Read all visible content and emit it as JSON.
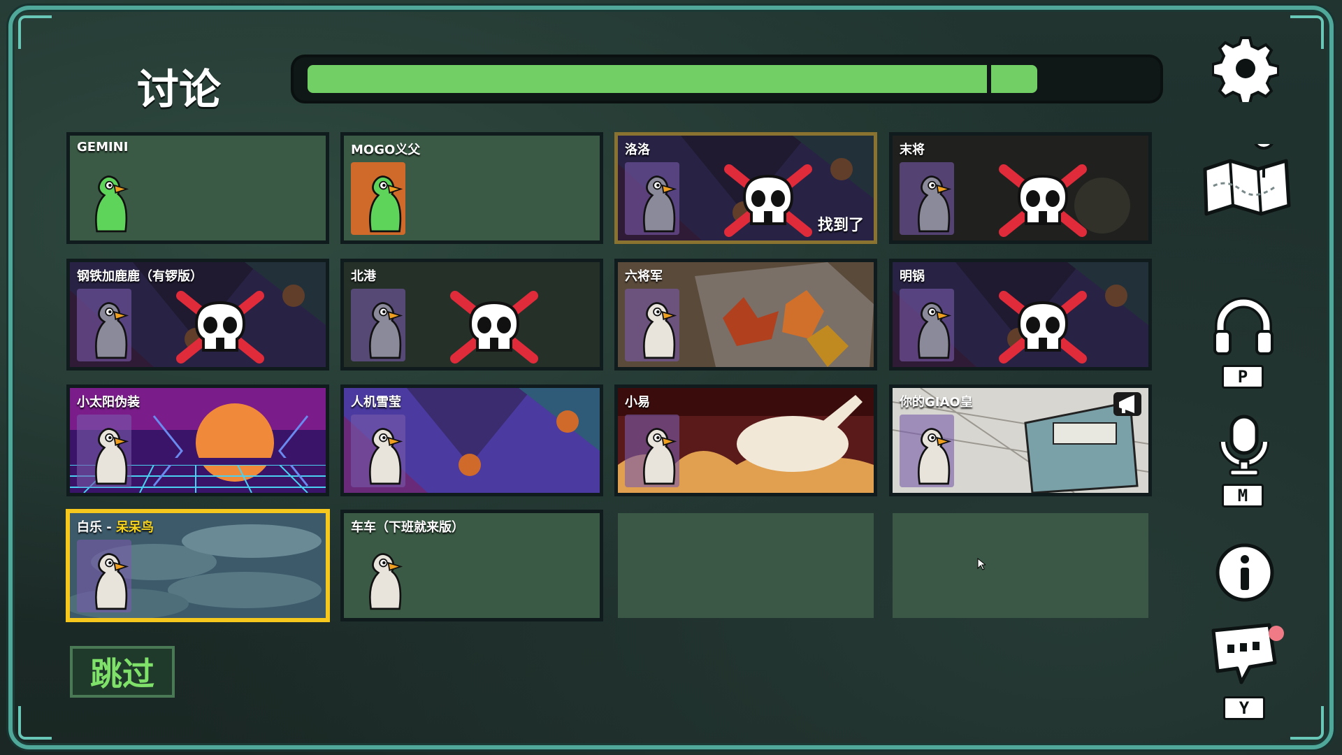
{
  "header": {
    "phase_title": "讨论",
    "timer_progress": 0.87
  },
  "players": [
    {
      "name": "GEMINI",
      "status": "alive",
      "avatar_color": "#5fd45b",
      "bg": "plain"
    },
    {
      "name": "MOGO义父",
      "status": "alive",
      "avatar_color": "#5fd45b",
      "bg": "plain"
    },
    {
      "name": "洛洛",
      "status": "dead",
      "found_label": "找到了",
      "bg": "jester"
    },
    {
      "name": "末将",
      "status": "dead",
      "bg": "dark"
    },
    {
      "name": "钢铁加鹿鹿（有锣版）",
      "status": "dead",
      "bg": "jester"
    },
    {
      "name": "北港",
      "status": "dead",
      "bg": "plain"
    },
    {
      "name": "六将军",
      "status": "alive",
      "bg": "leaves"
    },
    {
      "name": "明锅",
      "status": "dead",
      "bg": "jester"
    },
    {
      "name": "小太阳伪装",
      "status": "alive",
      "bg": "synthwave"
    },
    {
      "name": "人机雪莹",
      "status": "alive",
      "bg": "jester"
    },
    {
      "name": "小易",
      "status": "alive",
      "bg": "rabbit"
    },
    {
      "name": "你的GIAO皇",
      "status": "alive",
      "bg": "comic",
      "speaking": true
    },
    {
      "name": "白乐",
      "separator": " - ",
      "alias": "呆呆鸟",
      "status": "alive",
      "bg": "fish",
      "is_self": true
    },
    {
      "name": "车车（下班就来版）",
      "status": "alive",
      "bg": "plain"
    }
  ],
  "buttons": {
    "skip_label": "跳过"
  },
  "sidebar": {
    "settings": "gear-icon",
    "map": "map-icon",
    "voice_key": "P",
    "mic_key": "M",
    "info": "info-icon",
    "chat_key": "Y"
  },
  "colors": {
    "timer_green": "#72cf66",
    "frame_teal": "#4fa89a",
    "self_highlight": "#f6c81d",
    "dead_cross": "#e02b3a"
  }
}
